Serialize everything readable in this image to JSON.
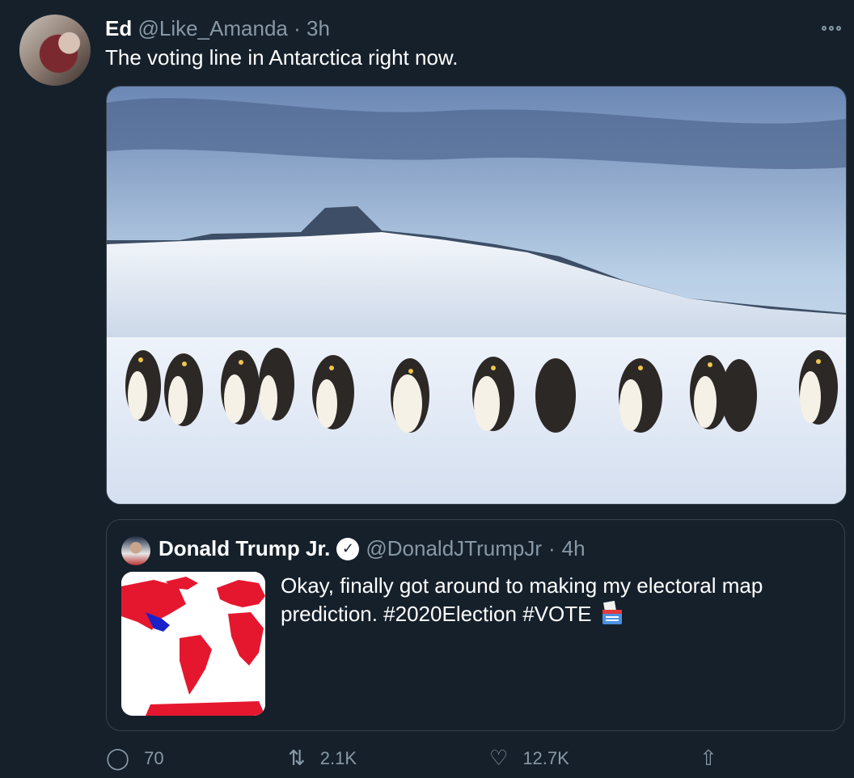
{
  "tweet": {
    "author_name": "Ed",
    "author_handle": "@Like_Amanda",
    "separator": "·",
    "time": "3h",
    "text": "The voting line in Antarctica right now."
  },
  "quoted_tweet": {
    "author_name": "Donald Trump Jr.",
    "author_handle": "@DonaldJTrumpJr",
    "separator": "·",
    "time": "4h",
    "text": "Okay, finally got around to making my electoral map prediction. #2020Election #VOTE"
  },
  "actions": {
    "reply_count": "70",
    "retweet_count": "2.1K",
    "like_count": "12.7K"
  },
  "icons": [
    "more-icon",
    "verified-icon",
    "ballot-box-icon",
    "reply-icon",
    "retweet-icon",
    "like-icon",
    "share-icon"
  ],
  "colors": {
    "background": "#15202b",
    "muted": "#8899a6",
    "border": "#38444d",
    "map_red": "#e5172f",
    "map_blue": "#1a22c9"
  }
}
